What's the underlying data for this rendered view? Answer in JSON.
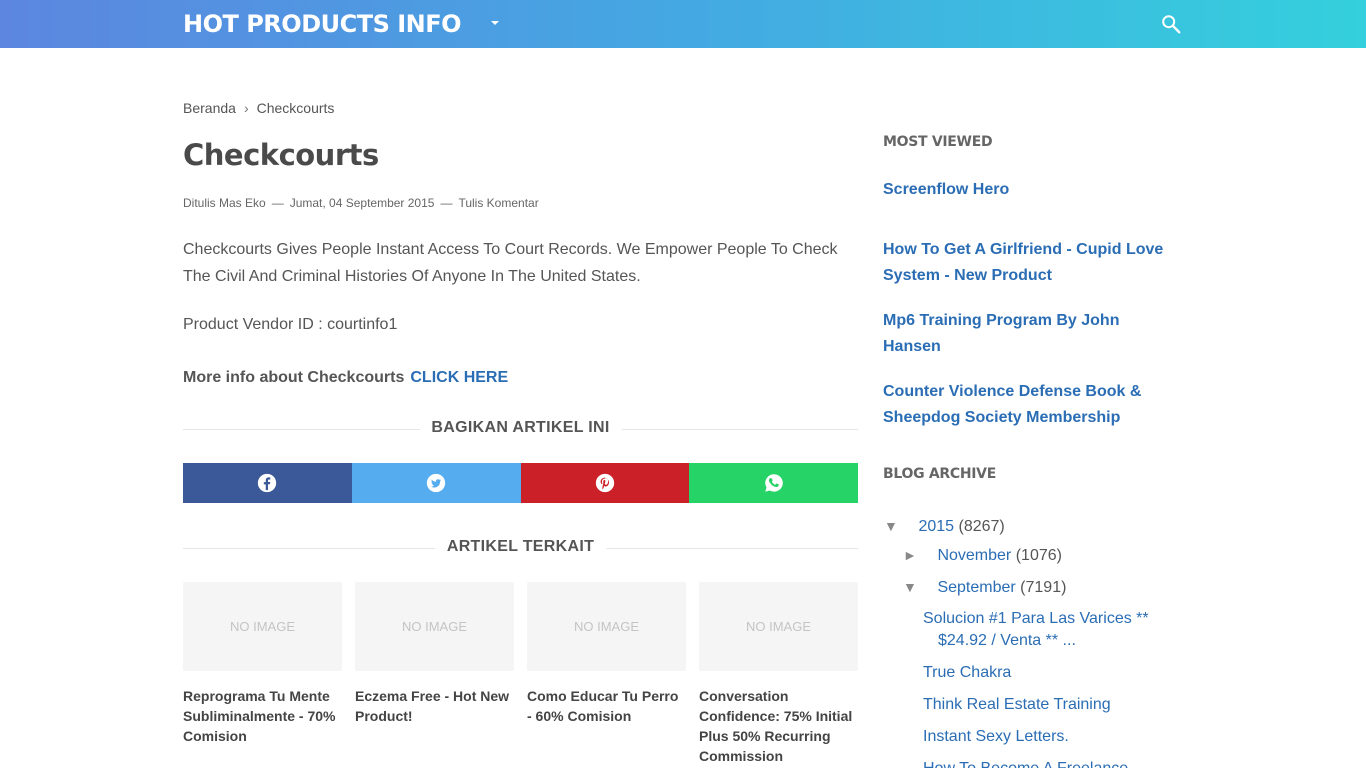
{
  "header": {
    "logo": "HOT PRODUCTS INFO",
    "colors": {
      "gradient_start": "#5c86e0",
      "gradient_end": "#34d0dd"
    },
    "icons": {
      "menu": "chevron-down-icon",
      "search": "search-icon"
    }
  },
  "breadcrumb": {
    "home": "Beranda",
    "separator": "›",
    "current": "Checkcourts"
  },
  "post": {
    "title": "Checkcourts",
    "author": "Ditulis Mas Eko",
    "date": "Jumat, 04 September 2015",
    "comment": "Tulis Komentar",
    "meta_separator": "—",
    "body": "Checkcourts Gives People Instant Access To Court Records. We Empower People To Check The Civil And Criminal Histories Of Anyone In The United States.",
    "vendor": "Product Vendor ID : courtinfo1",
    "more_info_label": "More info about Checkcourts",
    "more_info_link": "CLICK HERE"
  },
  "share": {
    "heading": "BAGIKAN ARTIKEL INI",
    "buttons": [
      {
        "icon": "facebook-icon",
        "color": "#3b5998"
      },
      {
        "icon": "twitter-icon",
        "color": "#55acee"
      },
      {
        "icon": "pinterest-icon",
        "color": "#cb2027"
      },
      {
        "icon": "whatsapp-icon",
        "color": "#25d366"
      }
    ]
  },
  "related": {
    "heading": "ARTIKEL TERKAIT",
    "no_image": "NO IMAGE",
    "items": [
      {
        "title": "Reprograma Tu Mente Subliminalmente - 70% Comision"
      },
      {
        "title": "Eczema Free - Hot New Product!"
      },
      {
        "title": "Como Educar Tu Perro - 60% Comision"
      },
      {
        "title": "Conversation Confidence: 75% Initial Plus 50% Recurring Commission"
      }
    ]
  },
  "sidebar": {
    "most_viewed_heading": "MOST VIEWED",
    "most_viewed": [
      "Screenflow Hero",
      "How To Get A Girlfriend - Cupid Love System - New Product",
      "Mp6 Training Program By John Hansen",
      "Counter Violence Defense Book & Sheepdog Society Membership"
    ],
    "archive_heading": "BLOG ARCHIVE",
    "archive": {
      "year": {
        "toggle": "▼",
        "label": "2015",
        "count": "(8267)"
      },
      "months": [
        {
          "toggle": "►",
          "label": "November",
          "count": "(1076)"
        },
        {
          "toggle": "▼",
          "label": "September",
          "count": "(7191)"
        }
      ],
      "posts": [
        "Solucion #1 Para Las Varices ** $24.92 / Venta ** ...",
        "True Chakra",
        "Think Real Estate Training",
        "Instant Sexy Letters.",
        "How To Become A Freelance..."
      ]
    }
  }
}
